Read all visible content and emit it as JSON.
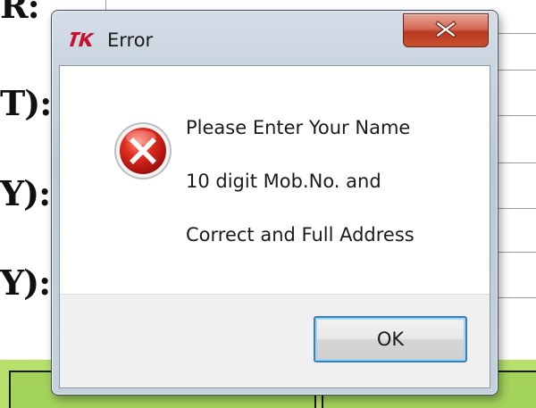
{
  "background_window": {
    "label_fragments": [
      "R:",
      "T):",
      "Y):",
      "Y):"
    ]
  },
  "dialog": {
    "app_icon": "tk-feather-icon",
    "title": "Error",
    "close_button_icon": "close-icon",
    "close_button_color": "#c8452a",
    "message_icon": "error-x-circle-icon",
    "message_icon_color": "#c21a1a",
    "message_lines": [
      "Please Enter Your Name",
      "10 digit Mob.No. and",
      "Correct and Full Address"
    ],
    "ok_label": "OK"
  }
}
